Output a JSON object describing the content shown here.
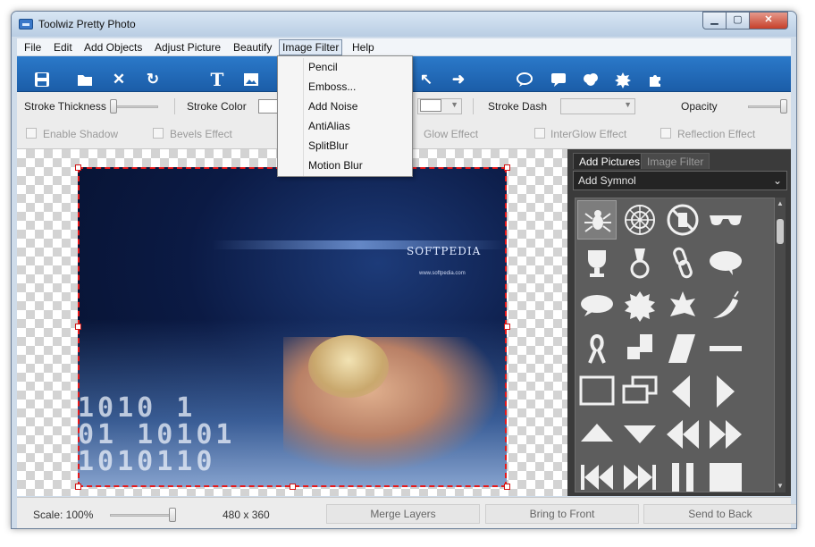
{
  "window": {
    "title": "Toolwiz Pretty Photo",
    "controls": {
      "minimize": "▁",
      "maximize": "▢",
      "close": "✕"
    }
  },
  "menu": [
    "File",
    "Edit",
    "Add Objects",
    "Adjust Picture",
    "Beautify",
    "Image Filter",
    "Help"
  ],
  "filter_menu": [
    "Pencil",
    "Emboss...",
    "Add Noise",
    "AntiAlias",
    "SplitBlur",
    "Motion Blur"
  ],
  "toolbar_icons": [
    "save-icon",
    "open-folder-icon",
    "delete-icon",
    "refresh-icon",
    "text-icon",
    "image-icon",
    "arrow-icon",
    "arrow-right-icon",
    "speech-bubble-icon",
    "callout-icon",
    "cloud-bubble-icon",
    "burst-bubble-icon",
    "puzzle-icon"
  ],
  "properties": {
    "stroke_thickness": "Stroke Thickness",
    "stroke_color": "Stroke Color",
    "stroke_dash": "Stroke Dash",
    "opacity": "Opacity",
    "effects": [
      "Enable Shadow",
      "Bevels Effect",
      "Glow Effect",
      "InterGlow Effect",
      "Reflection Effect"
    ]
  },
  "canvas": {
    "image_text": "SOFTPEDIA",
    "image_url": "www.softpedia.com",
    "digits": "1010 1\n01 10101\n1010110"
  },
  "right_panel": {
    "tabs": [
      "Add Pictures",
      "Image Filter"
    ],
    "active_tab": "Add Pictures",
    "select_value": "Add Symnol",
    "symbols": [
      "spider",
      "spider-web",
      "no-drinks",
      "sunglasses",
      "trophy",
      "medal",
      "chain",
      "speech-bubble",
      "oval-bubble",
      "splat",
      "burst",
      "chili",
      "ribbon",
      "steps",
      "parallelogram",
      "dash",
      "rectangle",
      "two-rectangles",
      "triangle-left",
      "triangle-right",
      "triangle-up",
      "triangle-down",
      "rewind",
      "fast-forward",
      "skip-back",
      "skip-forward",
      "pause",
      "stop"
    ]
  },
  "status": {
    "scale": "Scale: 100%",
    "scale_level": 1.0,
    "dimensions": "480 x 360",
    "buttons": [
      "Merge Layers",
      "Bring to Front",
      "Send to Back"
    ]
  }
}
